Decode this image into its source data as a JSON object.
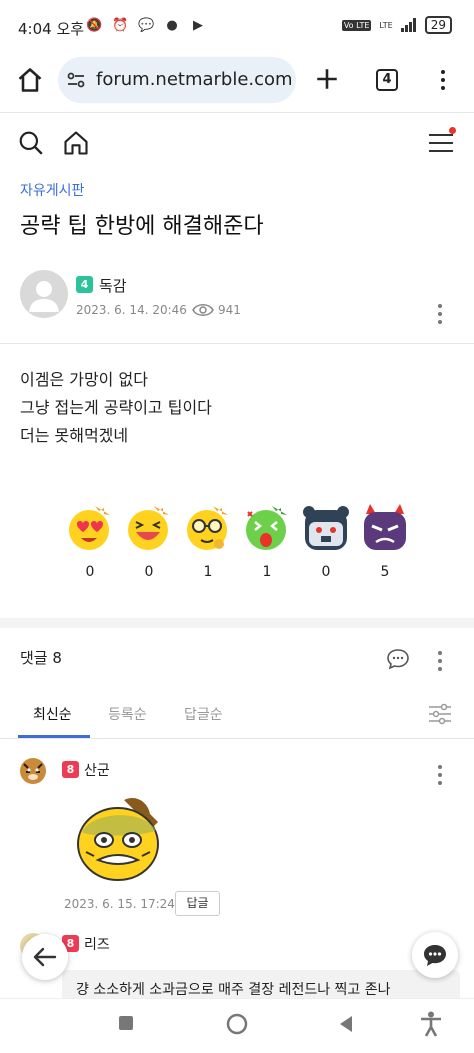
{
  "status_bar": {
    "time": "4:04 오후",
    "network_badge": "Vo LTE",
    "lte": "LTE",
    "battery": "29"
  },
  "browser": {
    "url": "forum.netmarble.com/",
    "tab_count": "4"
  },
  "post": {
    "category": "자유게시판",
    "title": "공략 팁 한방에 해결해준다",
    "author": {
      "level": "4",
      "name": "독감"
    },
    "date": "2023. 6. 14. 20:46",
    "views": "941",
    "body_lines": [
      "이겜은 가망이 없다",
      "그냥 접는게 공략이고 팁이다",
      "더는 못해먹겠네"
    ],
    "reactions": [
      {
        "icon": "heart-eyes-emoji-icon",
        "count": "0"
      },
      {
        "icon": "laughing-emoji-icon",
        "count": "0"
      },
      {
        "icon": "sunglasses-emoji-icon",
        "count": "1"
      },
      {
        "icon": "surprised-emoji-icon",
        "count": "1"
      },
      {
        "icon": "sad-bear-emoji-icon",
        "count": "0"
      },
      {
        "icon": "angry-emoji-icon",
        "count": "5"
      }
    ]
  },
  "comments": {
    "header": "댓글 8",
    "sort_tabs": [
      "최신순",
      "등록순",
      "답글순"
    ],
    "active_sort": "최신순",
    "items": [
      {
        "level": "8",
        "name": "산군",
        "date": "2023. 6. 15. 17:24",
        "reply_label": "답글"
      },
      {
        "level": "8",
        "name": "리즈",
        "text": "걍 소소하게 소과금으로 매주 결장 레전드나 찍고 존나"
      }
    ]
  },
  "colors": {
    "accent": "#3b6fd6",
    "level_green": "#2cc29a",
    "level_red": "#ee3b55",
    "notification_dot": "#e8322a"
  }
}
